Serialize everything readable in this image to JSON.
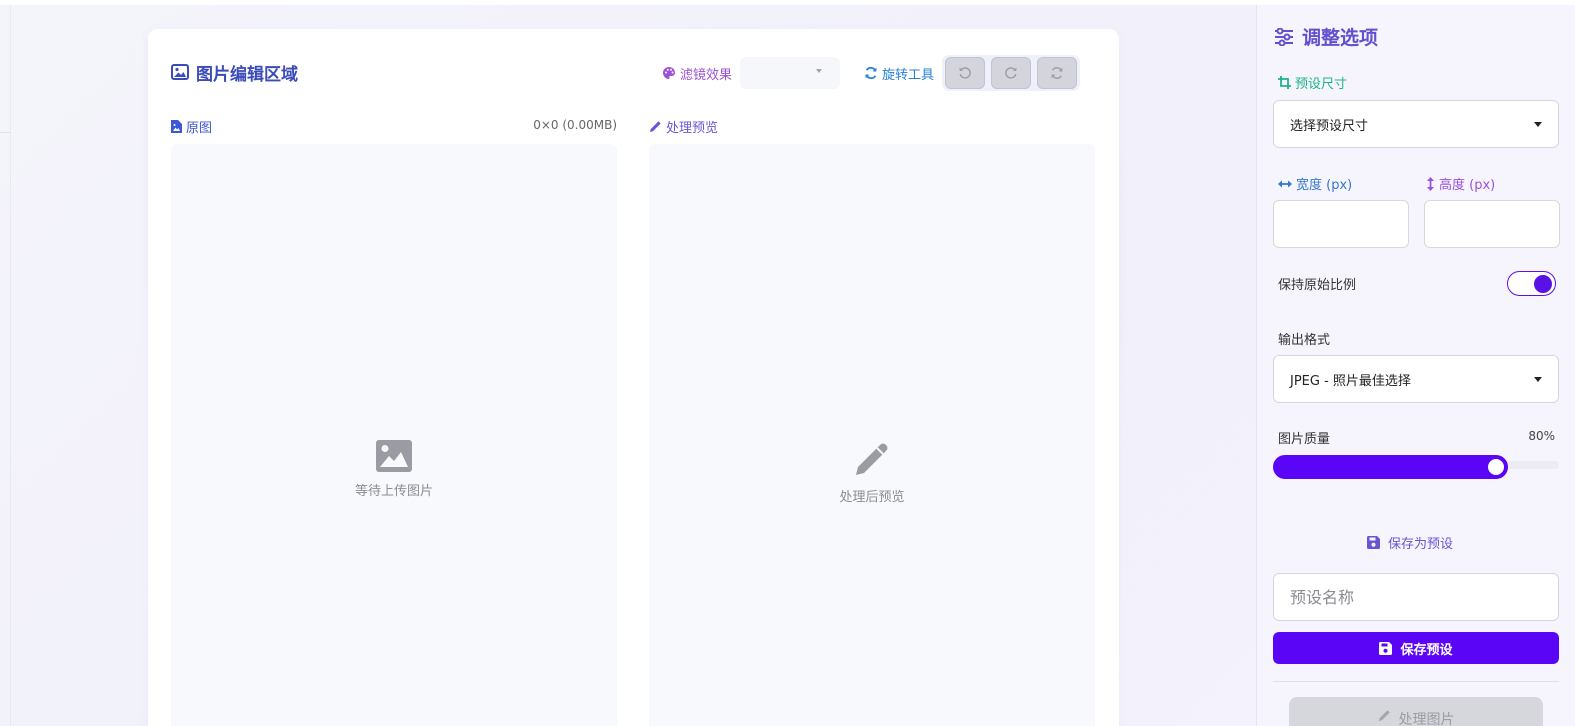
{
  "editor": {
    "title": "图片编辑区域",
    "filter_label": "滤镜效果",
    "filter_selected": "",
    "rotate_label": "旋转工具",
    "rotate_buttons": [
      "rotate-left",
      "rotate-right",
      "reset"
    ],
    "original": {
      "label": "原图",
      "size_info": "0×0 (0.00MB)",
      "placeholder": "等待上传图片"
    },
    "preview": {
      "label": "处理预览",
      "placeholder": "处理后预览"
    }
  },
  "sidebar": {
    "title": "调整选项",
    "preset_size_label": "预设尺寸",
    "preset_size_selected": "选择预设尺寸",
    "width_label": "宽度 (px)",
    "height_label": "高度 (px)",
    "width_value": "",
    "height_value": "",
    "keep_ratio_label": "保持原始比例",
    "keep_ratio_on": true,
    "format_label": "输出格式",
    "format_selected": "JPEG - 照片最佳选择",
    "quality_label": "图片质量",
    "quality_display": "80%",
    "quality_percent": 80,
    "save_as_preset_label": "保存为预设",
    "preset_name_placeholder": "预设名称",
    "save_preset_button": "保存预设",
    "process_button": "处理图片"
  },
  "colors": {
    "accent": "#5a05f5",
    "title_blue": "#3b4bb8",
    "preset_green": "#1fb48a",
    "filter_purple": "#9b52d6",
    "rotate_blue": "#2680d9"
  }
}
